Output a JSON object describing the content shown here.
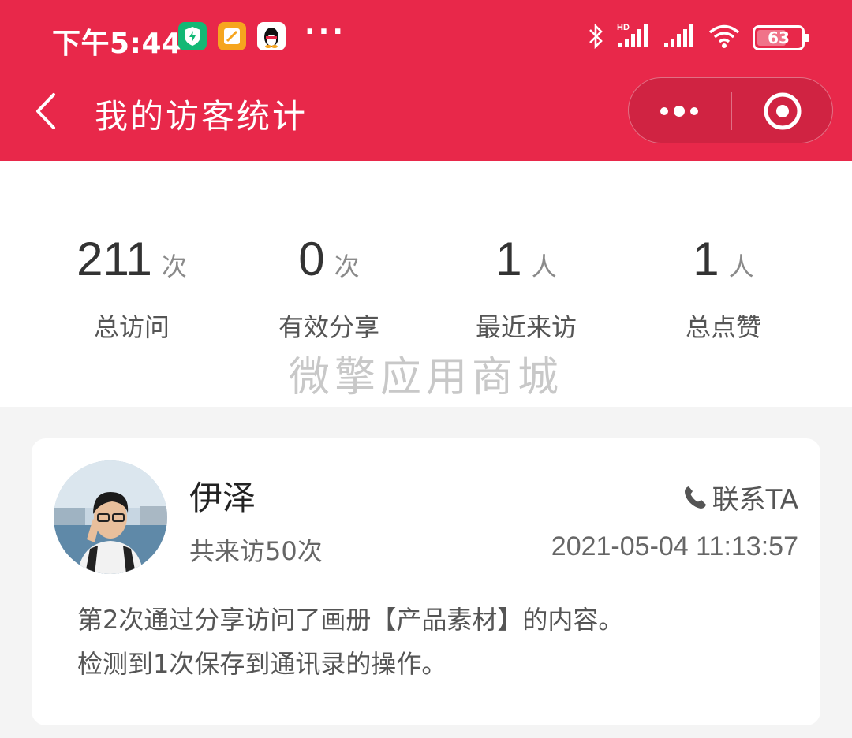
{
  "status_bar": {
    "time": "下午5:44",
    "more": "···",
    "battery": "63"
  },
  "nav": {
    "title": "我的访客统计"
  },
  "stats": [
    {
      "value": "211",
      "unit": "次",
      "label": "总访问"
    },
    {
      "value": "0",
      "unit": "次",
      "label": "有效分享"
    },
    {
      "value": "1",
      "unit": "人",
      "label": "最近来访"
    },
    {
      "value": "1",
      "unit": "人",
      "label": "总点赞"
    }
  ],
  "watermark": "微擎应用商城",
  "visitor": {
    "name": "伊泽",
    "contact_label": "联系TA",
    "visit_count": "共来访50次",
    "last_visit": "2021-05-04 11:13:57",
    "activity": [
      "第2次通过分享访问了画册【产品素材】的内容。",
      "检测到1次保存到通讯录的操作。"
    ]
  },
  "colors": {
    "brand": "#e8284a",
    "background": "#f4f4f4"
  }
}
